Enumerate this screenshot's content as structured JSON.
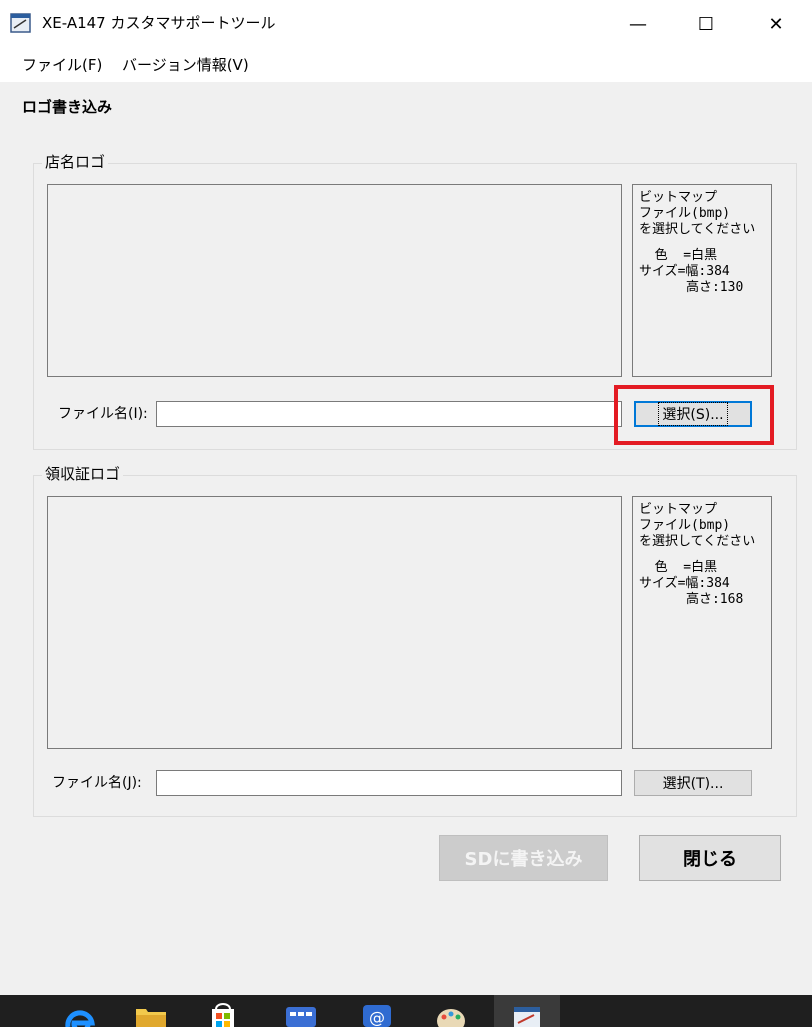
{
  "window": {
    "title": "XE-A147 カスタマサポートツール",
    "minimize": "—",
    "maximize": "☐",
    "close": "✕"
  },
  "menu": {
    "file": "ファイル(F)",
    "version": "バージョン情報(V)"
  },
  "section_title": "ロゴ書き込み",
  "store_logo": {
    "group_label": "店名ロゴ",
    "info": {
      "line1": "ビットマップ",
      "line2": "ファイル(bmp)",
      "line3": "を選択してください",
      "line4": "  色  =白黒",
      "line5": "サイズ=幅:384",
      "line6": "      高さ:130"
    },
    "file_label": "ファイル名(I):",
    "file_value": "",
    "select_button": "選択(S)..."
  },
  "receipt_logo": {
    "group_label": "領収証ロゴ",
    "info": {
      "line1": "ビットマップ",
      "line2": "ファイル(bmp)",
      "line3": "を選択してください",
      "line4": "  色  =白黒",
      "line5": "サイズ=幅:384",
      "line6": "      高さ:168"
    },
    "file_label": "ファイル名(J):",
    "file_value": "",
    "select_button": "選択(T)..."
  },
  "buttons": {
    "write_sd": "SDに書き込み",
    "close": "閉じる"
  },
  "colors": {
    "highlight": "#e31b23",
    "focus": "#0078d7",
    "taskbar": "#1f1f1f"
  }
}
